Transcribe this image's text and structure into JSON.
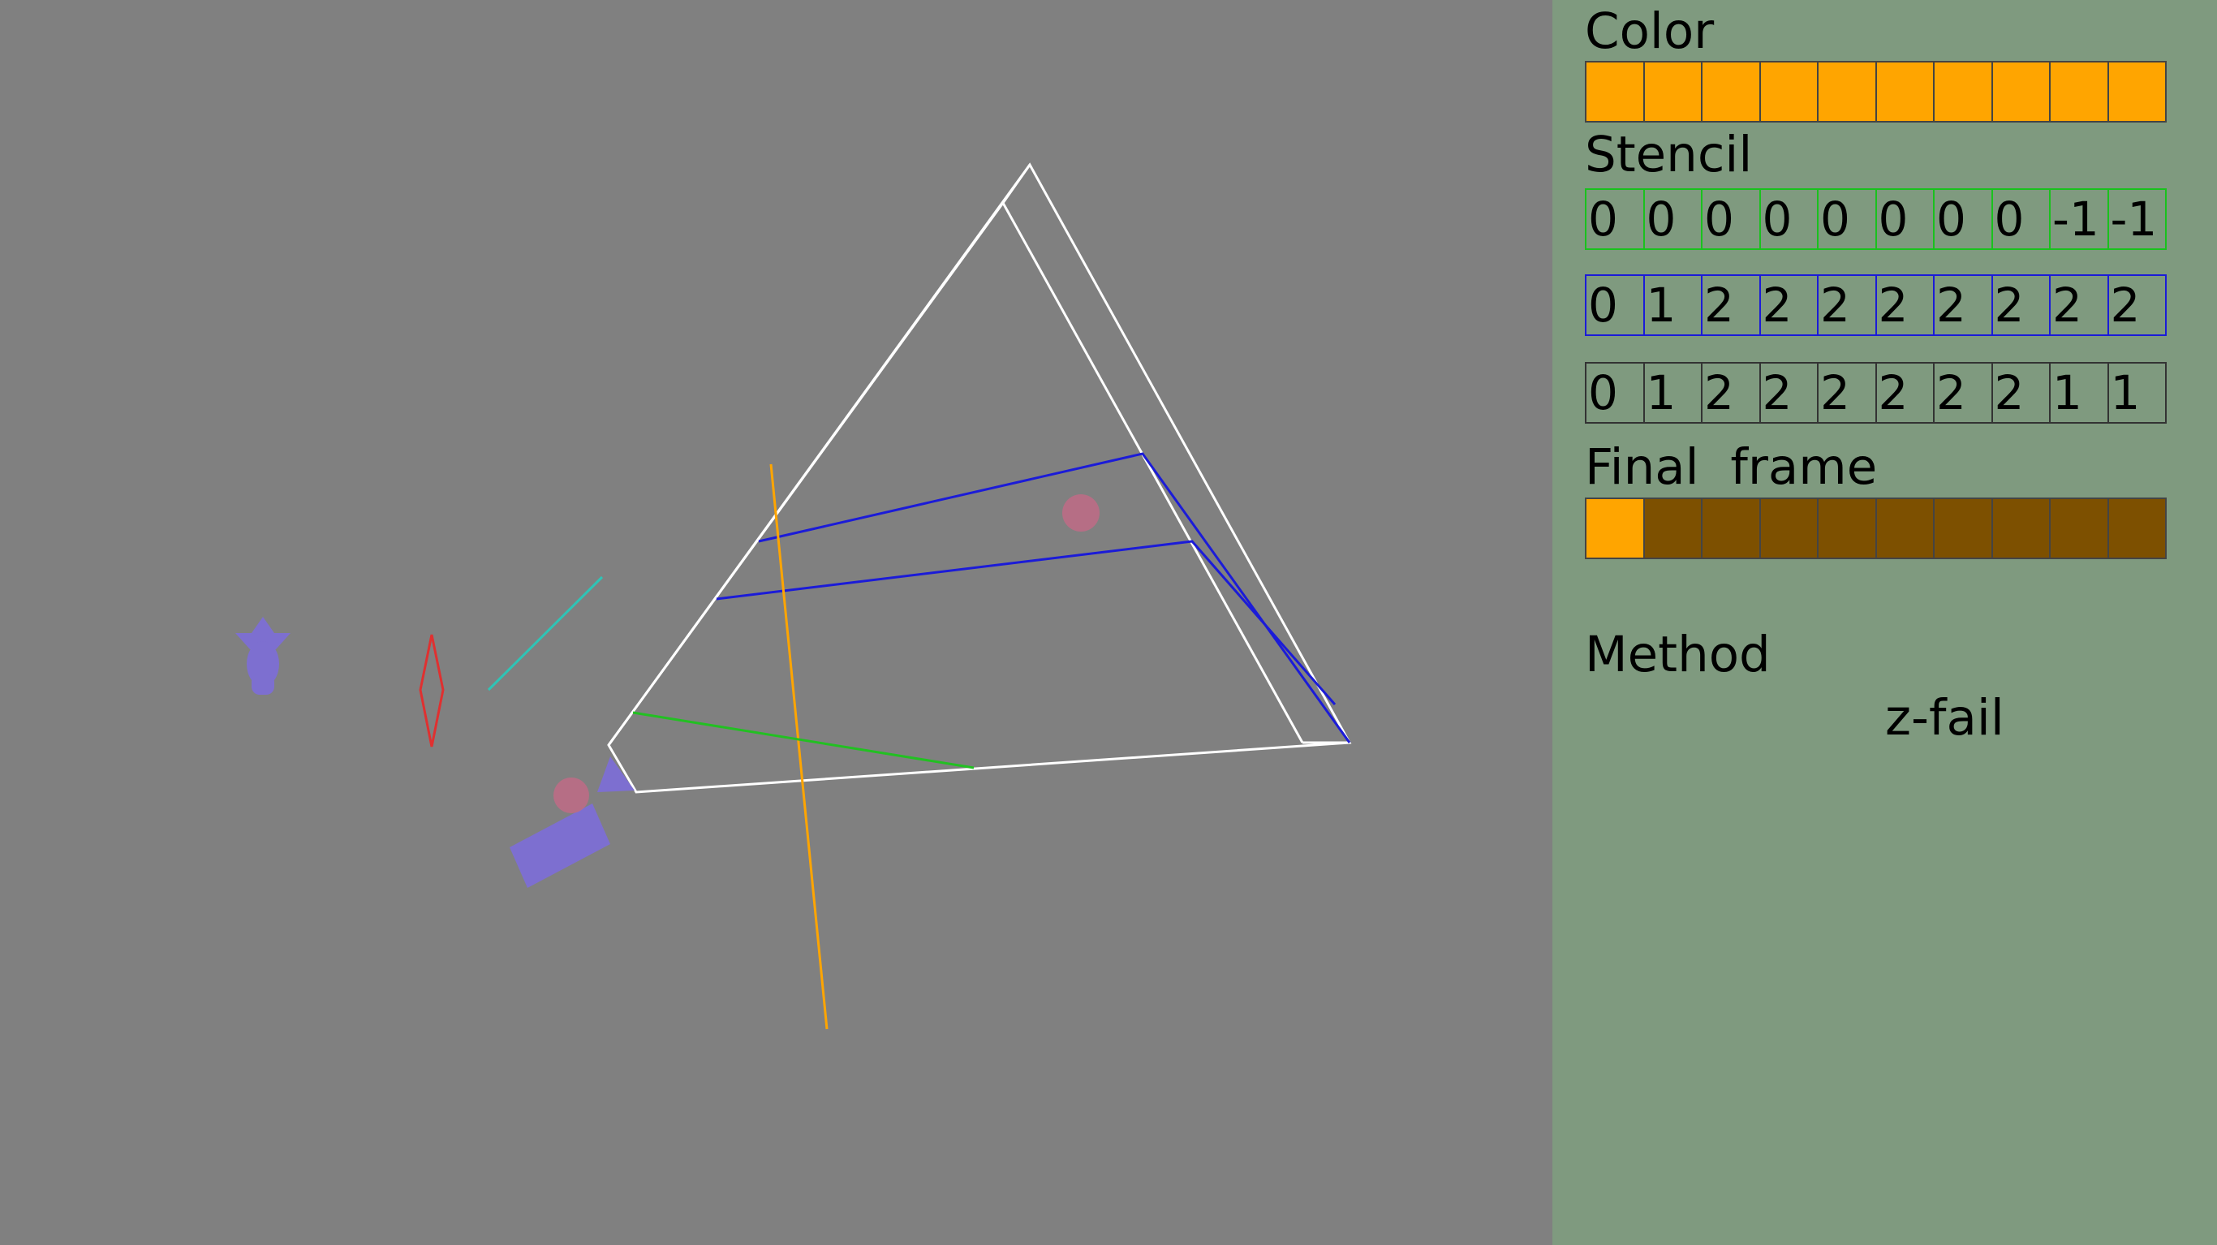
{
  "panel": {
    "color_title": "Color",
    "color_cells": [
      "#ffa500",
      "#ffa500",
      "#ffa500",
      "#ffa500",
      "#ffa500",
      "#ffa500",
      "#ffa500",
      "#ffa500",
      "#ffa500",
      "#ffa500"
    ],
    "stencil_title": "Stencil",
    "stencil_rows": [
      {
        "border": "green",
        "values": [
          "0",
          "0",
          "0",
          "0",
          "0",
          "0",
          "0",
          "0",
          "-1",
          "-1"
        ]
      },
      {
        "border": "blue",
        "values": [
          "0",
          "1",
          "2",
          "2",
          "2",
          "2",
          "2",
          "2",
          "2",
          "2"
        ]
      },
      {
        "border": "gray",
        "values": [
          "0",
          "1",
          "2",
          "2",
          "2",
          "2",
          "2",
          "2",
          "1",
          "1"
        ]
      }
    ],
    "final_title": "Final  frame",
    "final_cells": [
      "#ffa500",
      "#7d5000",
      "#7d5000",
      "#7d5000",
      "#7d5000",
      "#7d5000",
      "#7d5000",
      "#7d5000",
      "#7d5000",
      "#7d5000"
    ],
    "method_label": "Method",
    "method_value": "z-fail"
  },
  "scene": {
    "background": "#808080",
    "pyramid_color": "#ffffff",
    "shadow_volume_color": "#1b1bd8",
    "ray_color": "#ffa500",
    "ground_line_color": "#22c022",
    "light_ray_color": "#2ec4b6",
    "marker_color": "#e03030",
    "camera_color": "#7d6fd0",
    "ball_color": "#c06b86"
  }
}
